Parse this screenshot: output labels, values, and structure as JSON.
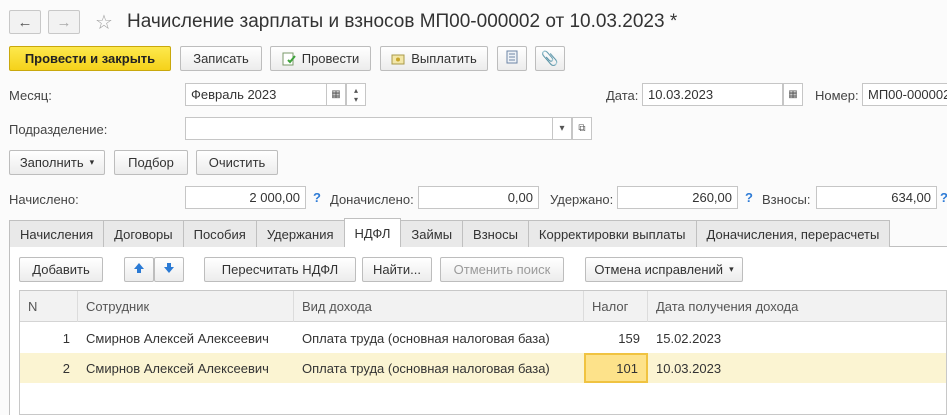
{
  "window": {
    "title": "Начисление зарплаты и взносов МП00-000002 от 10.03.2023 *"
  },
  "toolbar": {
    "post_close": "Провести и закрыть",
    "save": "Записать",
    "post": "Провести",
    "pay": "Выплатить"
  },
  "form": {
    "month_label": "Месяц:",
    "month_value": "Февраль 2023",
    "date_label": "Дата:",
    "date_value": "10.03.2023",
    "number_label": "Номер:",
    "number_value": "МП00-000002",
    "department_label": "Подразделение:",
    "department_value": ""
  },
  "actions": {
    "fill": "Заполнить",
    "select": "Подбор",
    "clear": "Очистить"
  },
  "totals": {
    "accrued_label": "Начислено:",
    "accrued_value": "2 000,00",
    "extra_label": "Доначислено:",
    "extra_value": "0,00",
    "withheld_label": "Удержано:",
    "withheld_value": "260,00",
    "contrib_label": "Взносы:",
    "contrib_value": "634,00",
    "help": "?"
  },
  "tabs": [
    "Начисления",
    "Договоры",
    "Пособия",
    "Удержания",
    "НДФЛ",
    "Займы",
    "Взносы",
    "Корректировки выплаты",
    "Доначисления, перерасчеты"
  ],
  "active_tab": "НДФЛ",
  "tab_toolbar": {
    "add": "Добавить",
    "recalc": "Пересчитать НДФЛ",
    "find": "Найти...",
    "cancel_search": "Отменить поиск",
    "undo_fix": "Отмена исправлений"
  },
  "table": {
    "columns": [
      "N",
      "Сотрудник",
      "Вид дохода",
      "Налог",
      "Дата получения дохода"
    ],
    "rows": [
      {
        "n": "1",
        "employee": "Смирнов Алексей Алексеевич",
        "income_type": "Оплата труда (основная налоговая база)",
        "tax": "159",
        "date": "15.02.2023"
      },
      {
        "n": "2",
        "employee": "Смирнов Алексей Алексеевич",
        "income_type": "Оплата труда (основная налоговая база)",
        "tax": "101",
        "date": "10.03.2023"
      }
    ]
  },
  "colors": {
    "primary_button": "#f5d21a",
    "selected_row": "#fbf4d2",
    "active_cell": "#fde28a",
    "help_blue": "#2f7cd6",
    "arrow_blue": "#2b7ad4"
  }
}
